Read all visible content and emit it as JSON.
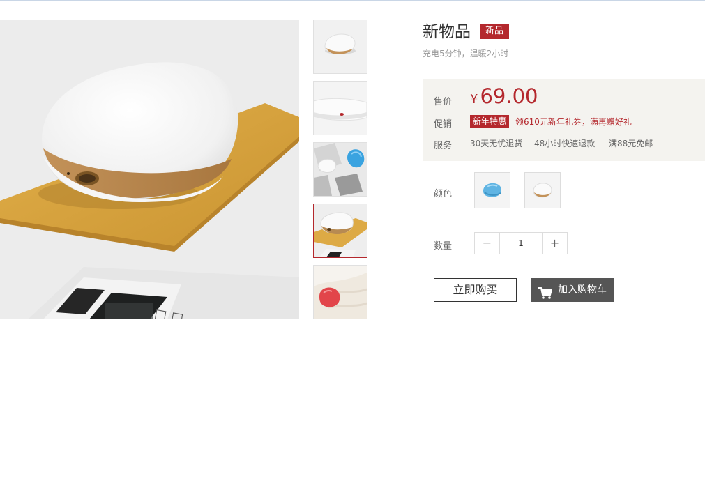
{
  "product": {
    "title": "新物品",
    "badge": "新品",
    "subtitle": "充电5分钟，温暖2小时"
  },
  "price": {
    "label": "售价",
    "currency": "¥",
    "value": "69.00"
  },
  "promotion": {
    "label": "促销",
    "tag": "新年特惠",
    "text": "领610元新年礼券，满再赠好礼"
  },
  "service": {
    "label": "服务",
    "items": [
      "30天无忧退货",
      "48小时快速退款",
      "满88元免邮"
    ]
  },
  "color": {
    "label": "颜色",
    "options": [
      {
        "name": "blue",
        "swatch": "#5fb4e3"
      },
      {
        "name": "white",
        "swatch": "#f2f2f2"
      }
    ]
  },
  "quantity": {
    "label": "数量",
    "minus": "−",
    "plus": "+",
    "value": "1"
  },
  "actions": {
    "buy_now": "立即购买",
    "add_to_cart": "加入购物车"
  },
  "gallery": {
    "thumbnail_count": 5,
    "selected_index": 3
  },
  "colors": {
    "accent": "#b4282d",
    "price_bg": "#f4f3ef",
    "cart_button": "#555555"
  }
}
